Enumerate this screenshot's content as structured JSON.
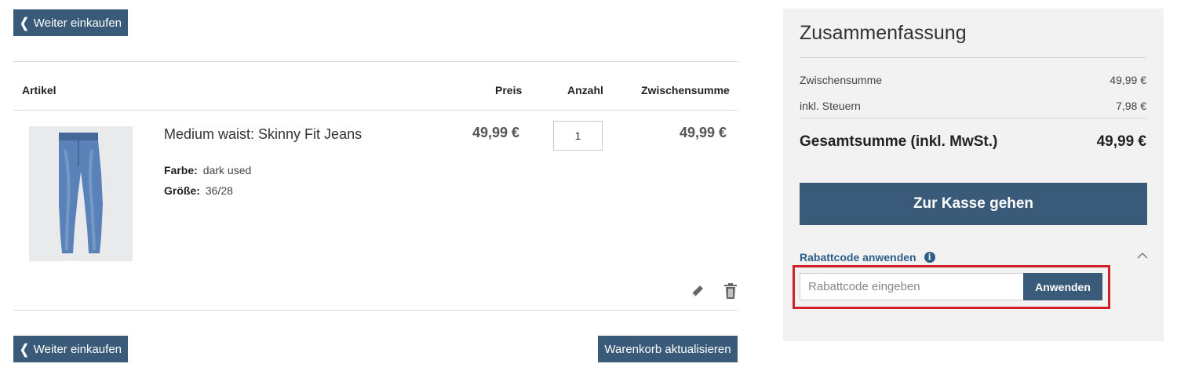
{
  "nav": {
    "continue_shopping_label": "Weiter einkaufen",
    "update_cart_label": "Warenkorb aktualisieren"
  },
  "cart": {
    "headers": {
      "item": "Artikel",
      "price": "Preis",
      "quantity": "Anzahl",
      "subtotal": "Zwischensumme"
    },
    "items": [
      {
        "name": "Medium waist: Skinny Fit Jeans",
        "color_label": "Farbe:",
        "color_value": "dark used",
        "size_label": "Größe:",
        "size_value": "36/28",
        "price": "49,99 €",
        "quantity": "1",
        "subtotal": "49,99 €",
        "image_icon": "jeans-product-image",
        "edit_icon": "pencil-icon",
        "delete_icon": "trash-icon"
      }
    ]
  },
  "summary": {
    "title": "Zusammenfassung",
    "subtotal_label": "Zwischensumme",
    "subtotal_value": "49,99 €",
    "tax_label": "inkl. Steuern",
    "tax_value": "7,98 €",
    "total_label": "Gesamtsumme (inkl. MwSt.)",
    "total_value": "49,99 €",
    "checkout_label": "Zur Kasse gehen",
    "coupon": {
      "toggle_label": "Rabattcode anwenden",
      "info_glyph": "i",
      "placeholder": "Rabattcode eingeben",
      "value": "",
      "apply_label": "Anwenden"
    }
  },
  "colors": {
    "primary": "#3a5a7a",
    "link": "#2e5f8a",
    "highlight": "#d0202a",
    "panel_bg": "#f2f2f2"
  }
}
